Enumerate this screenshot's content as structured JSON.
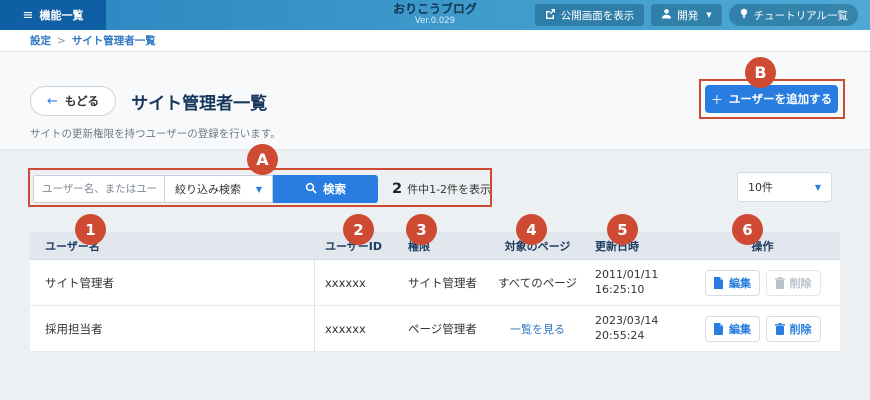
{
  "header": {
    "menu_label": "機能一覧",
    "app_title": "おりこうブログ",
    "version": "Ver.0.029",
    "preview_button": "公開画面を表示",
    "dev_button": "開発",
    "tutorial_button": "チュートリアル一覧"
  },
  "breadcrumb": {
    "items": [
      "設定",
      "サイト管理者一覧"
    ],
    "separator": ">"
  },
  "page": {
    "back_button": "もどる",
    "title": "サイト管理者一覧",
    "subtitle": "サイトの更新権限を持つユーザーの登録を行います。",
    "add_user_button": "ユーザーを追加する"
  },
  "search": {
    "placeholder": "ユーザー名、またはユーザー",
    "filter_dropdown": "絞り込み検索",
    "search_button": "検索",
    "count_value": "2",
    "count_suffix": "件中1-2件を表示",
    "per_page": "10件"
  },
  "table": {
    "headers": [
      "ユーザー名",
      "ユーザーID",
      "権限",
      "対象のページ",
      "更新日時",
      "操作"
    ],
    "rows": [
      {
        "name": "サイト管理者",
        "user_id": "xxxxxx",
        "role": "サイト管理者",
        "target_pages": "すべてのページ",
        "updated_date": "2011/01/11",
        "updated_time": "16:25:10",
        "edit_label": "編集",
        "delete_label": "削除"
      },
      {
        "name": "採用担当者",
        "user_id": "xxxxxx",
        "role": "ページ管理者",
        "target_pages": "一覧を見る",
        "updated_date": "2023/03/14",
        "updated_time": "20:55:24",
        "edit_label": "編集",
        "delete_label": "削除"
      }
    ]
  },
  "annotations": {
    "a": "A",
    "b": "B",
    "numbers": [
      "1",
      "2",
      "3",
      "4",
      "5",
      "6"
    ]
  },
  "icons": {
    "hamburger": "≡",
    "chevron_down": "▼",
    "back_arrow": "←",
    "plus": "＋",
    "breadcrumb_sep": ">"
  },
  "colors": {
    "primary": "#2a7de0",
    "header_dark": "#0f5fa4",
    "annotation_red": "#cf4a32",
    "link": "#2f7ac2"
  }
}
